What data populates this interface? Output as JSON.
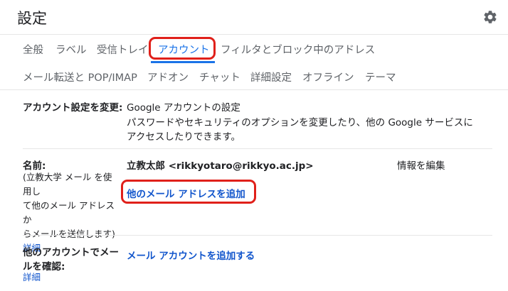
{
  "header": {
    "title": "設定"
  },
  "tabs_row1": [
    "全般",
    "ラベル",
    "受信トレイ",
    "アカウント",
    "フィルタとブロック中のアドレス"
  ],
  "tabs_row2": [
    "メール転送と POP/IMAP",
    "アドオン",
    "チャット",
    "詳細設定",
    "オフライン",
    "テーマ"
  ],
  "account_settings": {
    "label": "アカウント設定を変更:",
    "link": "Google アカウントの設定",
    "desc_line1": "パスワードやセキュリティのオプションを変更したり、他の Google サービスに",
    "desc_line2": "アクセスしたりできます。"
  },
  "name_section": {
    "label": "名前:",
    "hint_lines": [
      "(立教大学 メール を使用し",
      "て他のメール アドレスか",
      "らメールを送信します)"
    ],
    "detail_link": "詳細",
    "name_value": "立教太郎 <rikkyotaro@rikkyo.ac.jp>",
    "edit_link": "情報を編集",
    "add_address_link": "他のメール アドレスを追加"
  },
  "check_mail_section": {
    "label_line1": "他のアカウントでメー",
    "label_line2": "ルを確認:",
    "detail_link": "詳細",
    "add_account_link": "メール アカウントを追加する"
  },
  "colors": {
    "accent": "#1a73e8",
    "link": "#1155cc",
    "highlight": "#e0201a"
  }
}
